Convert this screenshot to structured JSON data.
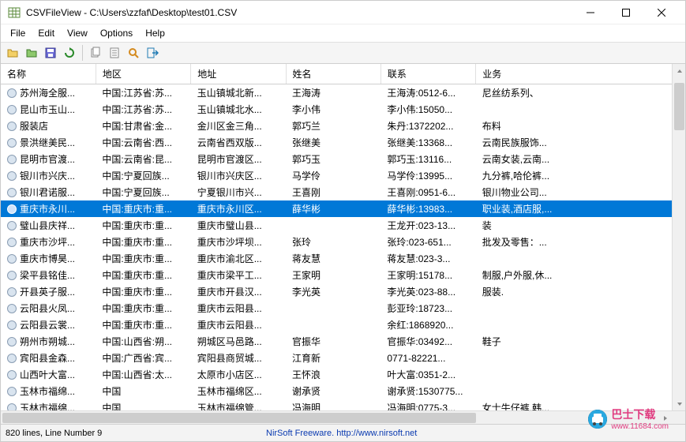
{
  "window": {
    "title": "CSVFileView  -  C:\\Users\\zzfaf\\Desktop\\test01.CSV"
  },
  "menu": [
    "File",
    "Edit",
    "View",
    "Options",
    "Help"
  ],
  "toolbar_icons": [
    "open-file-icon",
    "open-clipboard-icon",
    "save-icon",
    "refresh-icon",
    "copy-icon",
    "paste-icon",
    "find-icon",
    "exit-icon"
  ],
  "columns": [
    "名称",
    "地区",
    "地址",
    "姓名",
    "联系",
    "业务"
  ],
  "rows": [
    {
      "name": "苏州海全服...",
      "region": "中国:江苏省:苏...",
      "addr": "玉山镇城北新...",
      "fullname": "王海涛",
      "contact": "王海涛:0512-6...",
      "biz": "尼丝纺系列、"
    },
    {
      "name": "昆山市玉山...",
      "region": "中国:江苏省:苏...",
      "addr": "玉山镇城北水...",
      "fullname": "李小伟",
      "contact": "李小伟:15050...",
      "biz": ""
    },
    {
      "name": "服装店",
      "region": "中国:甘肃省:金...",
      "addr": "金川区金三角...",
      "fullname": "郭巧兰",
      "contact": "朱丹:1372202...",
      "biz": "布料"
    },
    {
      "name": "景洪继美民...",
      "region": "中国:云南省:西...",
      "addr": "云南省西双版...",
      "fullname": "张继美",
      "contact": "张继美:13368...",
      "biz": "云南民族服饰..."
    },
    {
      "name": "昆明市官渡...",
      "region": "中国:云南省:昆...",
      "addr": "昆明市官渡区...",
      "fullname": "郭巧玉",
      "contact": "郭巧玉:13116...",
      "biz": "云南女装,云南..."
    },
    {
      "name": "银川市兴庆...",
      "region": "中国:宁夏回族...",
      "addr": "银川市兴庆区...",
      "fullname": "马学伶",
      "contact": "马学伶:13995...",
      "biz": "九分裤,哈伦裤..."
    },
    {
      "name": "银川君诺服...",
      "region": "中国:宁夏回族...",
      "addr": "宁夏银川市兴...",
      "fullname": "王喜刚",
      "contact": "王喜刚:0951-6...",
      "biz": "银川物业公司..."
    },
    {
      "name": "重庆市永川...",
      "region": "中国:重庆市:重...",
      "addr": "重庆市永川区...",
      "fullname": "薛华彬",
      "contact": "薛华彬:13983...",
      "biz": "职业装,酒店服,...",
      "selected": true
    },
    {
      "name": "璧山县庆祥...",
      "region": "中国:重庆市:重...",
      "addr": "重庆市璧山县...",
      "fullname": "",
      "contact": "王龙开:023-13...",
      "biz": "装"
    },
    {
      "name": "重庆市沙坪...",
      "region": "中国:重庆市:重...",
      "addr": "重庆市沙坪坝...",
      "fullname": "张玲",
      "contact": "张玲:023-651...",
      "biz": "批发及零售：..."
    },
    {
      "name": "重庆市博昊...",
      "region": "中国:重庆市:重...",
      "addr": "重庆市渝北区...",
      "fullname": "蒋友慧",
      "contact": "蒋友慧:023-3...",
      "biz": ""
    },
    {
      "name": "梁平县铭佳...",
      "region": "中国:重庆市:重...",
      "addr": "重庆市梁平工...",
      "fullname": "王家明",
      "contact": "王家明:15178...",
      "biz": "制服,户外服,休..."
    },
    {
      "name": "开县英子服...",
      "region": "中国:重庆市:重...",
      "addr": "重庆市开县汉...",
      "fullname": "李光英",
      "contact": "李光英:023-88...",
      "biz": "服装."
    },
    {
      "name": "云阳县火凤...",
      "region": "中国:重庆市:重...",
      "addr": "重庆市云阳县...",
      "fullname": "",
      "contact": "彭亚玲:18723...",
      "biz": ""
    },
    {
      "name": "云阳县云裳...",
      "region": "中国:重庆市:重...",
      "addr": "重庆市云阳县...",
      "fullname": "",
      "contact": "余红:1868920...",
      "biz": ""
    },
    {
      "name": "朔州市朔城...",
      "region": "中国:山西省:朔...",
      "addr": "朔城区马邑路...",
      "fullname": "官振华",
      "contact": "官振华:03492...",
      "biz": "鞋子"
    },
    {
      "name": "宾阳县金森...",
      "region": "中国:广西省:宾...",
      "addr": "宾阳县商贸城...",
      "fullname": "江育新",
      "contact": "0771-82221...",
      "biz": ""
    },
    {
      "name": "山西叶大富...",
      "region": "中国:山西省:太...",
      "addr": "太原市小店区...",
      "fullname": "王怀浪",
      "contact": "叶大富:0351-2...",
      "biz": ""
    },
    {
      "name": "玉林市福绵...",
      "region": "中国",
      "addr": "玉林市福绵区...",
      "fullname": "谢承贤",
      "contact": "谢承贤:1530775...",
      "biz": ""
    },
    {
      "name": "玉林市福绵...",
      "region": "中国",
      "addr": "玉林市福绵管...",
      "fullname": "冯海明",
      "contact": "冯海明:0775-3...",
      "biz": "女士牛仔裤,韩..."
    }
  ],
  "status": {
    "left": "820 lines, Line Number 9",
    "mid": "NirSoft Freeware.  http://www.nirsoft.net"
  },
  "watermark": {
    "text": "巴士下载",
    "domain": "www.11684.com"
  }
}
